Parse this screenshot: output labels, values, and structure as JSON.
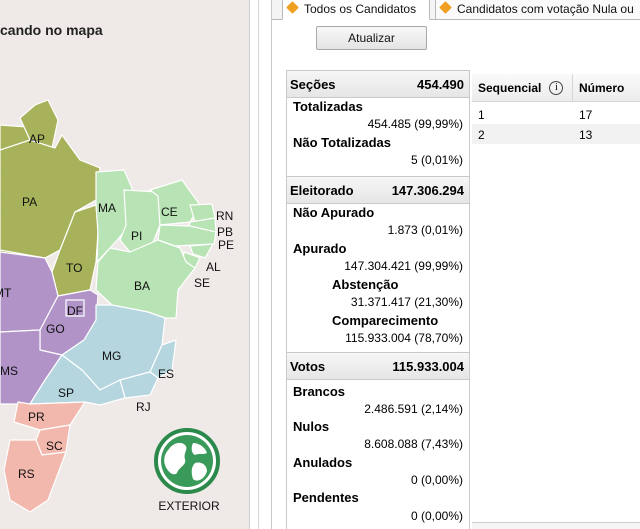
{
  "map": {
    "title": "cando no mapa",
    "exterior_label": "EXTERIOR",
    "states": [
      "AP",
      "PA",
      "MA",
      "CE",
      "RN",
      "PB",
      "PE",
      "AL",
      "SE",
      "PI",
      "TO",
      "BA",
      "DF",
      "GO",
      "MT",
      "MG",
      "ES",
      "MS",
      "SP",
      "RJ",
      "PR",
      "SC",
      "RS"
    ],
    "colors": {
      "north": "#a7b25a",
      "northeast": "#b8e3b4",
      "center_west": "#b193c8",
      "southeast": "#b5d6df",
      "south": "#f2b8ad",
      "border": "#ffffff"
    }
  },
  "tabs": {
    "todos": "Todos os Candidatos",
    "nula": "Candidatos com votação Nula ou"
  },
  "toolbar": {
    "refresh_label": "Atualizar"
  },
  "stats": {
    "secoes": {
      "label": "Seções",
      "value": "454.490"
    },
    "totalizadas": {
      "label": "Totalizadas",
      "value": "454.485 (99,99%)"
    },
    "nao_totalizadas": {
      "label": "Não Totalizadas",
      "value": "5 (0,01%)"
    },
    "eleitorado": {
      "label": "Eleitorado",
      "value": "147.306.294"
    },
    "nao_apurado": {
      "label": "Não Apurado",
      "value": "1.873 (0,01%)"
    },
    "apurado": {
      "label": "Apurado",
      "value": "147.304.421 (99,99%)"
    },
    "abstencao": {
      "label": "Abstenção",
      "value": "31.371.417 (21,30%)"
    },
    "comparecimento": {
      "label": "Comparecimento",
      "value": "115.933.004 (78,70%)"
    },
    "votos": {
      "label": "Votos",
      "value": "115.933.004"
    },
    "brancos": {
      "label": "Brancos",
      "value": "2.486.591 (2,14%)"
    },
    "nulos": {
      "label": "Nulos",
      "value": "8.608.088 (7,43%)"
    },
    "anulados": {
      "label": "Anulados",
      "value": "0 (0,00%)"
    },
    "pendentes": {
      "label": "Pendentes",
      "value": "0 (0,00%)"
    }
  },
  "table": {
    "columns": [
      "Sequencial",
      "Número"
    ],
    "info_glyph": "i",
    "rows": [
      {
        "sequencial": "1",
        "numero": "17"
      },
      {
        "sequencial": "2",
        "numero": "13"
      }
    ]
  }
}
